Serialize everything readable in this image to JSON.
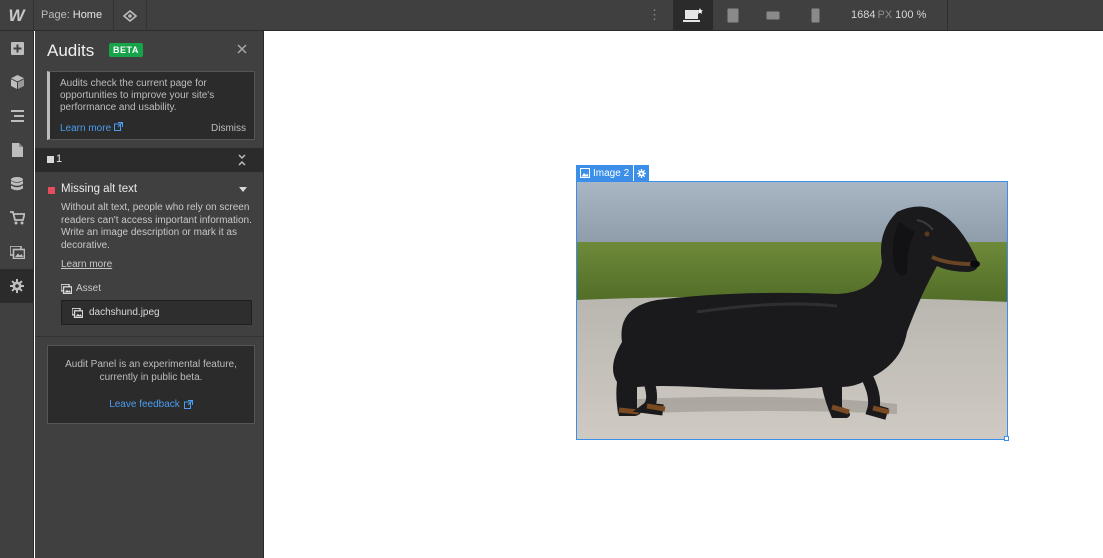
{
  "topbar": {
    "logo": "W",
    "page_prefix": "Page:",
    "page_name": "Home",
    "kebab": "⋮",
    "width_value": "1684",
    "width_unit": "PX",
    "zoom": "100 %"
  },
  "rail": {
    "items": [
      "add-panel",
      "components",
      "navigator",
      "pages",
      "cms",
      "ecommerce",
      "assets",
      "settings"
    ]
  },
  "audits": {
    "title": "Audits",
    "badge": "BETA",
    "intro": "Audits check the current page for opportunities to improve your site's performance and usability.",
    "learn_more": "Learn more",
    "dismiss": "Dismiss",
    "group_count": "1",
    "issue": {
      "title": "Missing alt text",
      "description": "Without alt text, people who rely on screen readers can't access important information. Write an image description or mark it as decorative.",
      "learn_more": "Learn more",
      "asset_label": "Asset",
      "asset_file": "dachshund.jpeg"
    },
    "feedback": {
      "text": "Audit Panel is an experimental feature, currently in public beta.",
      "link": "Leave feedback"
    }
  },
  "canvas": {
    "selected_label": "Image 2"
  },
  "colors": {
    "accent": "#3b8fe8",
    "beta": "#16a34a",
    "error": "#e74c5e",
    "link": "#4a9df0"
  }
}
